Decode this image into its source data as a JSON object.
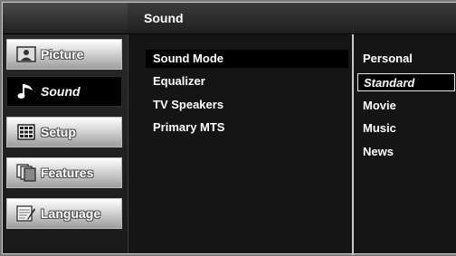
{
  "header": {
    "title": "Sound"
  },
  "sidebar": {
    "items": [
      {
        "label": "Picture",
        "icon": "picture-icon",
        "active": false
      },
      {
        "label": "Sound",
        "icon": "music-note-icon",
        "active": true
      },
      {
        "label": "Setup",
        "icon": "grid-setup-icon",
        "active": false
      },
      {
        "label": "Features",
        "icon": "features-icon",
        "active": false
      },
      {
        "label": "Language",
        "icon": "language-icon",
        "active": false
      }
    ]
  },
  "menu": {
    "items": [
      {
        "label": "Sound Mode",
        "highlighted": true
      },
      {
        "label": "Equalizer"
      },
      {
        "label": "TV Speakers"
      },
      {
        "label": "Primary MTS"
      }
    ]
  },
  "options": {
    "selected": "Standard",
    "items": [
      {
        "label": "Personal"
      },
      {
        "label": "Standard"
      },
      {
        "label": "Movie"
      },
      {
        "label": "Music"
      },
      {
        "label": "News"
      }
    ]
  }
}
